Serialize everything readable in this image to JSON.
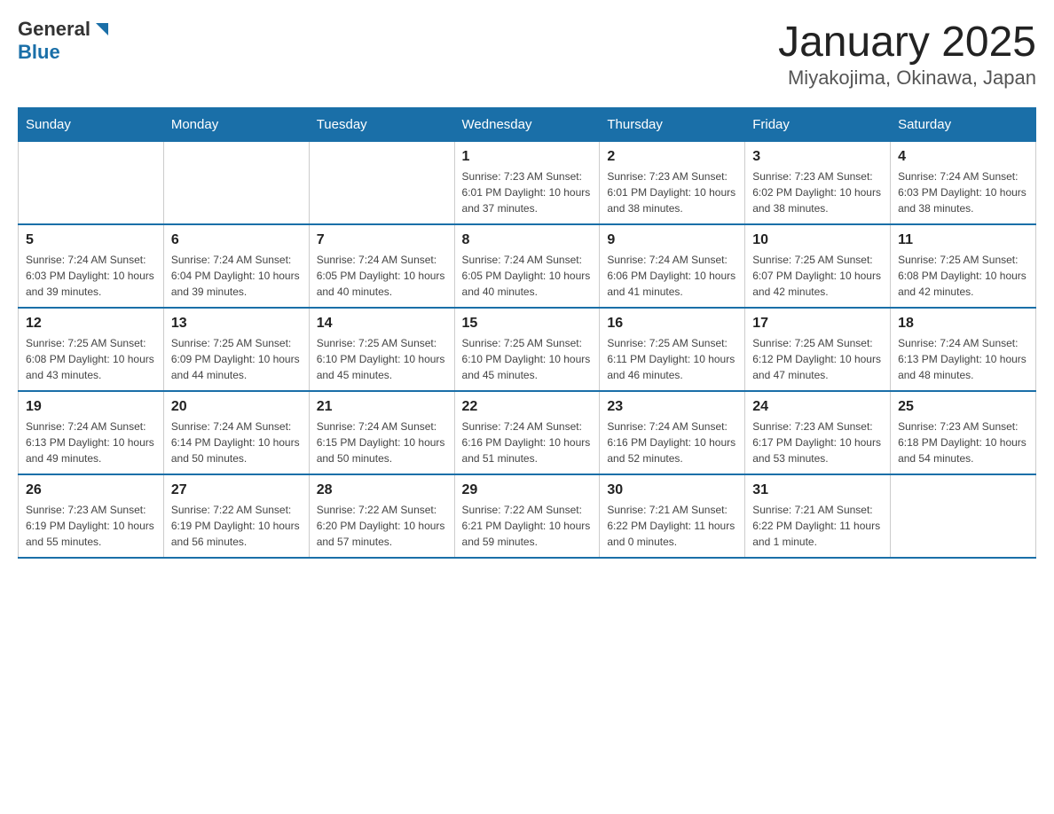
{
  "header": {
    "logo": {
      "general": "General",
      "blue": "Blue"
    },
    "title": "January 2025",
    "subtitle": "Miyakojima, Okinawa, Japan"
  },
  "days_of_week": [
    "Sunday",
    "Monday",
    "Tuesday",
    "Wednesday",
    "Thursday",
    "Friday",
    "Saturday"
  ],
  "weeks": [
    [
      {
        "day": "",
        "info": ""
      },
      {
        "day": "",
        "info": ""
      },
      {
        "day": "",
        "info": ""
      },
      {
        "day": "1",
        "info": "Sunrise: 7:23 AM\nSunset: 6:01 PM\nDaylight: 10 hours\nand 37 minutes."
      },
      {
        "day": "2",
        "info": "Sunrise: 7:23 AM\nSunset: 6:01 PM\nDaylight: 10 hours\nand 38 minutes."
      },
      {
        "day": "3",
        "info": "Sunrise: 7:23 AM\nSunset: 6:02 PM\nDaylight: 10 hours\nand 38 minutes."
      },
      {
        "day": "4",
        "info": "Sunrise: 7:24 AM\nSunset: 6:03 PM\nDaylight: 10 hours\nand 38 minutes."
      }
    ],
    [
      {
        "day": "5",
        "info": "Sunrise: 7:24 AM\nSunset: 6:03 PM\nDaylight: 10 hours\nand 39 minutes."
      },
      {
        "day": "6",
        "info": "Sunrise: 7:24 AM\nSunset: 6:04 PM\nDaylight: 10 hours\nand 39 minutes."
      },
      {
        "day": "7",
        "info": "Sunrise: 7:24 AM\nSunset: 6:05 PM\nDaylight: 10 hours\nand 40 minutes."
      },
      {
        "day": "8",
        "info": "Sunrise: 7:24 AM\nSunset: 6:05 PM\nDaylight: 10 hours\nand 40 minutes."
      },
      {
        "day": "9",
        "info": "Sunrise: 7:24 AM\nSunset: 6:06 PM\nDaylight: 10 hours\nand 41 minutes."
      },
      {
        "day": "10",
        "info": "Sunrise: 7:25 AM\nSunset: 6:07 PM\nDaylight: 10 hours\nand 42 minutes."
      },
      {
        "day": "11",
        "info": "Sunrise: 7:25 AM\nSunset: 6:08 PM\nDaylight: 10 hours\nand 42 minutes."
      }
    ],
    [
      {
        "day": "12",
        "info": "Sunrise: 7:25 AM\nSunset: 6:08 PM\nDaylight: 10 hours\nand 43 minutes."
      },
      {
        "day": "13",
        "info": "Sunrise: 7:25 AM\nSunset: 6:09 PM\nDaylight: 10 hours\nand 44 minutes."
      },
      {
        "day": "14",
        "info": "Sunrise: 7:25 AM\nSunset: 6:10 PM\nDaylight: 10 hours\nand 45 minutes."
      },
      {
        "day": "15",
        "info": "Sunrise: 7:25 AM\nSunset: 6:10 PM\nDaylight: 10 hours\nand 45 minutes."
      },
      {
        "day": "16",
        "info": "Sunrise: 7:25 AM\nSunset: 6:11 PM\nDaylight: 10 hours\nand 46 minutes."
      },
      {
        "day": "17",
        "info": "Sunrise: 7:25 AM\nSunset: 6:12 PM\nDaylight: 10 hours\nand 47 minutes."
      },
      {
        "day": "18",
        "info": "Sunrise: 7:24 AM\nSunset: 6:13 PM\nDaylight: 10 hours\nand 48 minutes."
      }
    ],
    [
      {
        "day": "19",
        "info": "Sunrise: 7:24 AM\nSunset: 6:13 PM\nDaylight: 10 hours\nand 49 minutes."
      },
      {
        "day": "20",
        "info": "Sunrise: 7:24 AM\nSunset: 6:14 PM\nDaylight: 10 hours\nand 50 minutes."
      },
      {
        "day": "21",
        "info": "Sunrise: 7:24 AM\nSunset: 6:15 PM\nDaylight: 10 hours\nand 50 minutes."
      },
      {
        "day": "22",
        "info": "Sunrise: 7:24 AM\nSunset: 6:16 PM\nDaylight: 10 hours\nand 51 minutes."
      },
      {
        "day": "23",
        "info": "Sunrise: 7:24 AM\nSunset: 6:16 PM\nDaylight: 10 hours\nand 52 minutes."
      },
      {
        "day": "24",
        "info": "Sunrise: 7:23 AM\nSunset: 6:17 PM\nDaylight: 10 hours\nand 53 minutes."
      },
      {
        "day": "25",
        "info": "Sunrise: 7:23 AM\nSunset: 6:18 PM\nDaylight: 10 hours\nand 54 minutes."
      }
    ],
    [
      {
        "day": "26",
        "info": "Sunrise: 7:23 AM\nSunset: 6:19 PM\nDaylight: 10 hours\nand 55 minutes."
      },
      {
        "day": "27",
        "info": "Sunrise: 7:22 AM\nSunset: 6:19 PM\nDaylight: 10 hours\nand 56 minutes."
      },
      {
        "day": "28",
        "info": "Sunrise: 7:22 AM\nSunset: 6:20 PM\nDaylight: 10 hours\nand 57 minutes."
      },
      {
        "day": "29",
        "info": "Sunrise: 7:22 AM\nSunset: 6:21 PM\nDaylight: 10 hours\nand 59 minutes."
      },
      {
        "day": "30",
        "info": "Sunrise: 7:21 AM\nSunset: 6:22 PM\nDaylight: 11 hours\nand 0 minutes."
      },
      {
        "day": "31",
        "info": "Sunrise: 7:21 AM\nSunset: 6:22 PM\nDaylight: 11 hours\nand 1 minute."
      },
      {
        "day": "",
        "info": ""
      }
    ]
  ]
}
